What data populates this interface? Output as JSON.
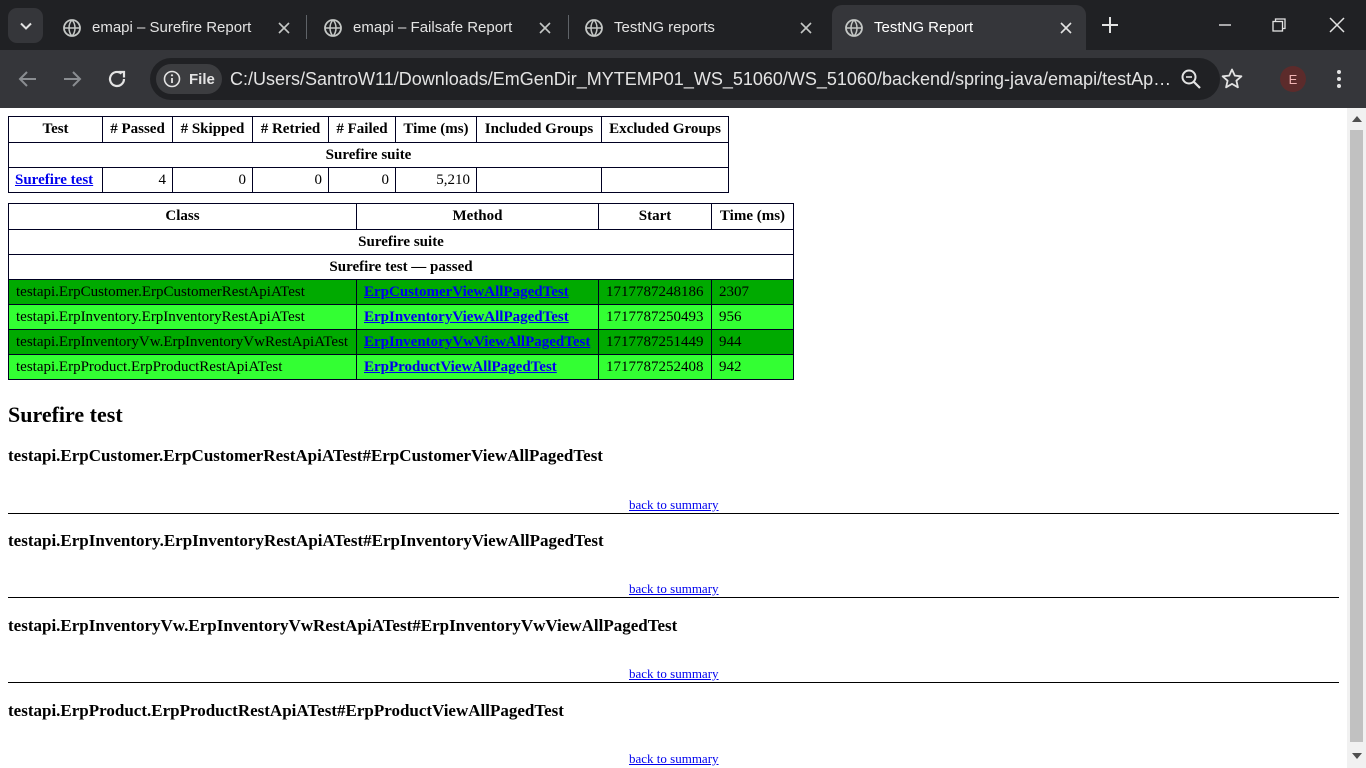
{
  "browser": {
    "tabs": [
      {
        "title": "emapi – Surefire Report",
        "active": false
      },
      {
        "title": "emapi – Failsafe Report",
        "active": false
      },
      {
        "title": "TestNG reports",
        "active": false
      },
      {
        "title": "TestNG Report",
        "active": true
      }
    ],
    "chip_label": "File",
    "url": "C:/Users/SantroW11/Downloads/EmGenDir_MYTEMP01_WS_51060/WS_51060/backend/spring-java/emapi/testApi/dbreports/testng-results.xml",
    "avatar_letter": "E"
  },
  "summary": {
    "headers": [
      "Test",
      "# Passed",
      "# Skipped",
      "# Retried",
      "# Failed",
      "Time (ms)",
      "Included Groups",
      "Excluded Groups"
    ],
    "suite": "Surefire suite",
    "row": {
      "test": "Surefire test",
      "passed": "4",
      "skipped": "0",
      "retried": "0",
      "failed": "0",
      "time": "5,210",
      "included": "",
      "excluded": ""
    }
  },
  "methods": {
    "headers": [
      "Class",
      "Method",
      "Start",
      "Time (ms)"
    ],
    "suite": "Surefire suite",
    "test_status": "Surefire test — passed",
    "rows": [
      {
        "class": "testapi.ErpCustomer.ErpCustomerRestApiATest",
        "method": "ErpCustomerViewAllPagedTest",
        "start": "1717787248186",
        "time": "2307"
      },
      {
        "class": "testapi.ErpInventory.ErpInventoryRestApiATest",
        "method": "ErpInventoryViewAllPagedTest",
        "start": "1717787250493",
        "time": "956"
      },
      {
        "class": "testapi.ErpInventoryVw.ErpInventoryVwRestApiATest",
        "method": "ErpInventoryVwViewAllPagedTest",
        "start": "1717787251449",
        "time": "944"
      },
      {
        "class": "testapi.ErpProduct.ErpProductRestApiATest",
        "method": "ErpProductViewAllPagedTest",
        "start": "1717787252408",
        "time": "942"
      }
    ]
  },
  "details": {
    "heading": "Surefire test",
    "back_label": "back to summary",
    "sections": [
      "testapi.ErpCustomer.ErpCustomerRestApiATest#ErpCustomerViewAllPagedTest",
      "testapi.ErpInventory.ErpInventoryRestApiATest#ErpInventoryViewAllPagedTest",
      "testapi.ErpInventoryVw.ErpInventoryVwRestApiATest#ErpInventoryVwViewAllPagedTest",
      "testapi.ErpProduct.ErpProductRestApiATest#ErpProductViewAllPagedTest"
    ]
  },
  "colors": {
    "passed_even": "#00aa00",
    "passed_odd": "#33ff33",
    "chrome_dark": "#202124",
    "chrome_toolbar": "#35363a"
  }
}
